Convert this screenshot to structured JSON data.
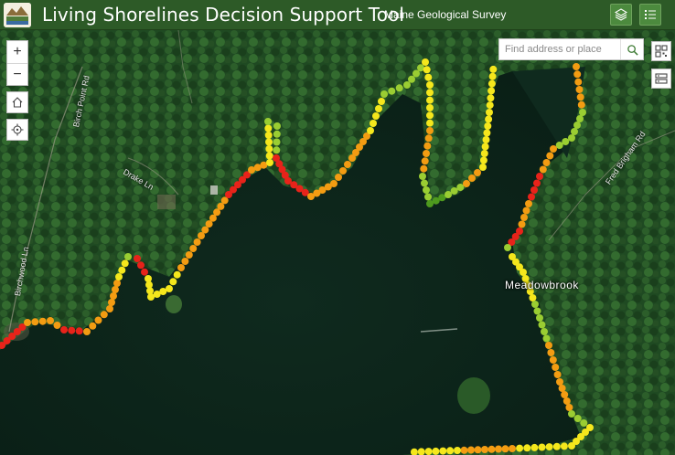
{
  "header": {
    "title": "Living Shorelines Decision Support Tool",
    "organization": "Maine Geological Survey",
    "layers_button_icon": "layers-icon",
    "list_button_icon": "list-icon"
  },
  "map": {
    "search": {
      "placeholder": "Find address or place",
      "button_icon": "search-icon"
    },
    "zoom_in_label": "+",
    "zoom_out_label": "−",
    "home_icon": "home-icon",
    "locate_icon": "locate-icon",
    "qr_icon": "qr-code-icon",
    "basemap_icon": "basemap-icon",
    "place_label": "Meadowbrook",
    "road_labels": [
      "Birch Point Rd",
      "Drake Ln",
      "Birchwood Ln",
      "Fred Brigham Rd"
    ],
    "suitability_colors": {
      "high": "#4e9a1e",
      "moderate_high": "#9acd32",
      "moderate": "#f5e71c",
      "low": "#f39c12",
      "very_low": "#e8231a"
    }
  }
}
